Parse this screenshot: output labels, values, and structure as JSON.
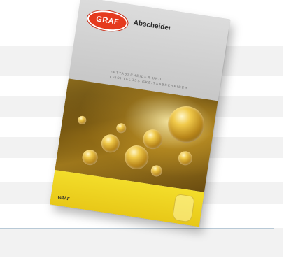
{
  "page": {
    "background": "#ffffff",
    "band_color": "#f2f2f2",
    "border_color": "#c9dbe8"
  },
  "brochure": {
    "brand_logo_text": "GRAF",
    "title": "Abscheider",
    "subtitle_lines": [
      "FETTABSCHEIDER UND",
      "LEICHTFLÜSSIGKEITSABSCHEIDER"
    ],
    "footer_mark": "GRAF",
    "colors": {
      "brand_red": "#e53a1e",
      "footer_yellow": "#f0d425",
      "header_gray": "#d0d0d0"
    }
  }
}
